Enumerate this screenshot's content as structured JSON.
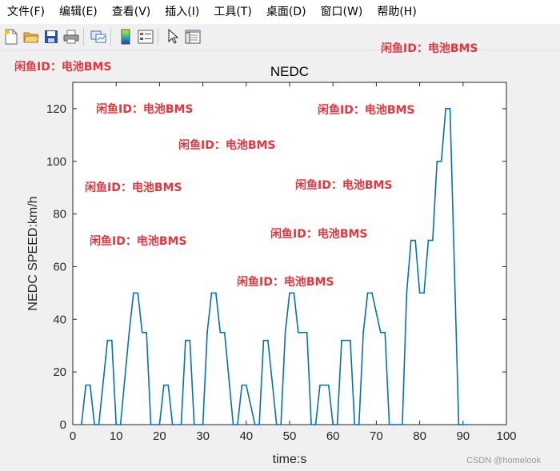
{
  "menu": [
    "文件(F)",
    "编辑(E)",
    "查看(V)",
    "插入(I)",
    "工具(T)",
    "桌面(D)",
    "窗口(W)",
    "帮助(H)"
  ],
  "toolbar": [
    "new-file-icon",
    "open-folder-icon",
    "save-icon",
    "print-icon",
    "link-plot-icon",
    "colorbar-icon",
    "legend-icon",
    "pointer-icon",
    "property-editor-icon"
  ],
  "watermark": "闲鱼ID：电池BMS",
  "credit": "CSDN @homelook",
  "chart_data": {
    "type": "line",
    "title": "NEDC",
    "xlabel": "time:s",
    "ylabel": "NEDC SPEED:km/h",
    "xlim": [
      0,
      100
    ],
    "ylim": [
      0,
      130
    ],
    "xticks": [
      0,
      10,
      20,
      30,
      40,
      50,
      60,
      70,
      80,
      90,
      100
    ],
    "yticks": [
      0,
      20,
      40,
      60,
      80,
      100,
      120
    ],
    "grid": false,
    "series": [
      {
        "color": "#0072bd",
        "x": [
          2,
          3,
          4,
          5,
          6,
          8,
          9,
          10,
          11,
          13,
          14,
          15,
          16,
          17,
          18,
          20,
          21,
          22,
          23,
          25,
          26,
          27,
          28,
          30,
          31,
          32,
          33,
          34,
          35,
          37,
          38,
          39,
          40,
          42,
          43,
          44,
          45,
          47,
          48,
          49,
          50,
          51,
          52,
          54,
          55,
          56,
          57,
          59,
          60,
          61,
          62,
          64,
          65,
          66,
          67,
          68,
          69,
          71,
          72,
          73,
          74,
          76,
          77,
          78,
          79,
          80,
          81,
          82,
          83,
          84,
          85,
          86,
          87,
          89,
          90,
          91
        ],
        "y": [
          0,
          15,
          15,
          0,
          0,
          32,
          32,
          0,
          0,
          35,
          50,
          50,
          35,
          35,
          0,
          0,
          15,
          15,
          0,
          0,
          32,
          32,
          0,
          0,
          35,
          50,
          50,
          35,
          35,
          0,
          0,
          15,
          15,
          0,
          0,
          32,
          32,
          0,
          0,
          35,
          50,
          50,
          35,
          35,
          0,
          0,
          15,
          15,
          0,
          0,
          32,
          32,
          0,
          0,
          35,
          50,
          50,
          35,
          35,
          0,
          0,
          0,
          50,
          70,
          70,
          50,
          50,
          70,
          70,
          100,
          100,
          120,
          120,
          0,
          0,
          0
        ]
      }
    ]
  }
}
